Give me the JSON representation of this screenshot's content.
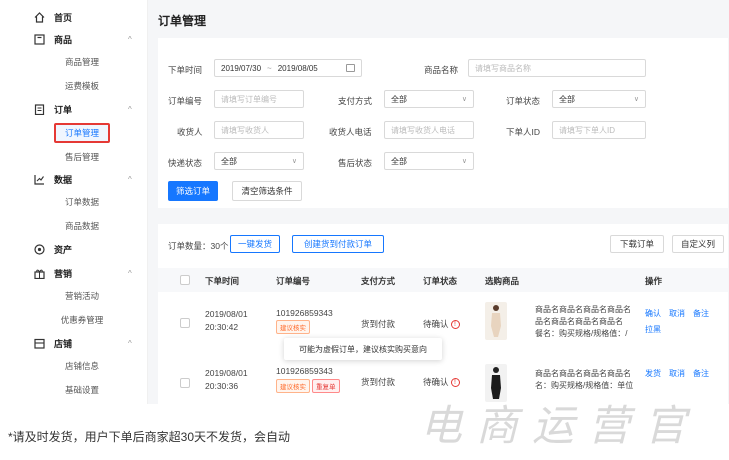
{
  "sidebar": {
    "groups": [
      {
        "icon": "home-icon",
        "label": "首页",
        "caret": ""
      },
      {
        "icon": "product-icon",
        "label": "商品",
        "caret": "^"
      },
      {
        "icon": "order-icon",
        "label": "订单",
        "caret": "^"
      },
      {
        "icon": "chart-icon",
        "label": "数据",
        "caret": "^"
      },
      {
        "icon": "asset-icon",
        "label": "资产",
        "caret": ""
      },
      {
        "icon": "marketing-icon",
        "label": "营销",
        "caret": "^"
      },
      {
        "icon": "store-icon",
        "label": "店铺",
        "caret": "^"
      }
    ],
    "items": {
      "product_manage": "商品管理",
      "shipping_template": "运费模板",
      "order_manage": "订单管理",
      "after_sale": "售后管理",
      "order_data": "订单数据",
      "product_data": "商品数据",
      "marketing_activity": "营销活动",
      "coupon_manage": "优惠券管理",
      "store_info": "店铺信息",
      "basic_settings": "基础设置"
    }
  },
  "page_title": "订单管理",
  "filters": {
    "order_time_label": "下单时间",
    "date_start": "2019/07/30",
    "date_sep": "~",
    "date_end": "2019/08/05",
    "product_name_label": "商品名称",
    "product_name_placeholder": "请填写商品名称",
    "order_no_label": "订单编号",
    "order_no_placeholder": "请填写订单编号",
    "payment_label": "支付方式",
    "payment_value": "全部",
    "order_status_label": "订单状态",
    "order_status_value": "全部",
    "receiver_label": "收货人",
    "receiver_placeholder": "请填写收货人",
    "receiver_phone_label": "收货人电话",
    "receiver_phone_placeholder": "请填写收货人电话",
    "buyer_id_label": "下单人ID",
    "buyer_id_placeholder": "请填写下单人ID",
    "express_status_label": "快递状态",
    "express_status_value": "全部",
    "after_sale_status_label": "售后状态",
    "after_sale_status_value": "全部",
    "filter_button": "筛选订单",
    "clear_button": "清空筛选条件"
  },
  "table": {
    "count_label": "订单数量：30个",
    "one_click_ship": "一键发货",
    "create_cod_order": "创建货到付款订单",
    "download_button": "下载订单",
    "custom_column_button": "自定义列",
    "headers": [
      "下单时间",
      "订单编号",
      "支付方式",
      "订单状态",
      "选购商品",
      "操作"
    ],
    "rows": [
      {
        "date": "2019/08/01",
        "time": "20:30:42",
        "order_no": "101926859343",
        "tags": [
          "建议核实"
        ],
        "payment": "货到付款",
        "status": "待确认",
        "product_line1": "商品名商品名商品名商品名",
        "product_line2": "品名商品名商品名商品名",
        "product_line3": "餐名：购买规格/规格值：/",
        "op1": "确认",
        "op2": "取消",
        "op3": "备注",
        "op4": "拉黑"
      },
      {
        "date": "2019/08/01",
        "time": "20:30:36",
        "order_no": "101926859343",
        "tags": [
          "建议核实",
          "重复单"
        ],
        "payment": "货到付款",
        "status": "待确认",
        "product_line1": "商品名商品名商品名商品名",
        "product_line2": "名：购买规格/规格值：单位",
        "op1": "发货",
        "op2": "取消",
        "op3": "备注"
      }
    ],
    "tooltip": "可能为虚假订单，建议核实购买意向"
  },
  "caption": "*请及时发货，用户下单后商家超30天不发货，会自动",
  "watermark": "电商运营官",
  "colors": {
    "accent": "#1677ff",
    "highlight": "#e53935"
  }
}
